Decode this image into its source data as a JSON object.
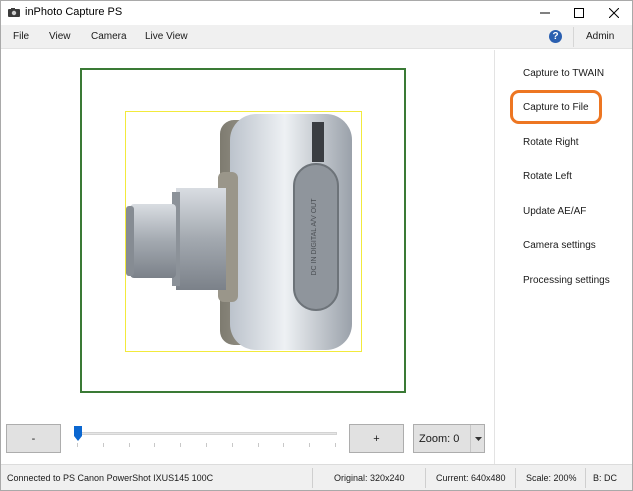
{
  "window": {
    "title": "inPhoto Capture PS"
  },
  "menu": {
    "items": [
      "File",
      "View",
      "Camera",
      "Live View"
    ],
    "admin_label": "Admin",
    "help_glyph": "?"
  },
  "actions": [
    "Capture to TWAIN",
    "Capture to File",
    "Rotate Right",
    "Rotate Left",
    "Update AE/AF",
    "Camera settings",
    "Processing settings"
  ],
  "highlighted_action": "Capture to File",
  "highlight_color": "#ed7622",
  "preview": {
    "image": "camera-product-photo",
    "frame_color": "#3a7a35",
    "crop_color": "#f2ea3c",
    "camera_label": "DC IN DIGITAL A/V OUT"
  },
  "controls": {
    "minus_label": "-",
    "plus_label": "+",
    "zoom_label": "Zoom: 0",
    "zoom_level_fraction": 0.0
  },
  "status": {
    "connection": "Connected to PS Canon PowerShot IXUS145 100C",
    "original": "Original: 320x240",
    "current": "Current: 640x480",
    "scale": "Scale: 200%",
    "mode": "B: DC"
  }
}
